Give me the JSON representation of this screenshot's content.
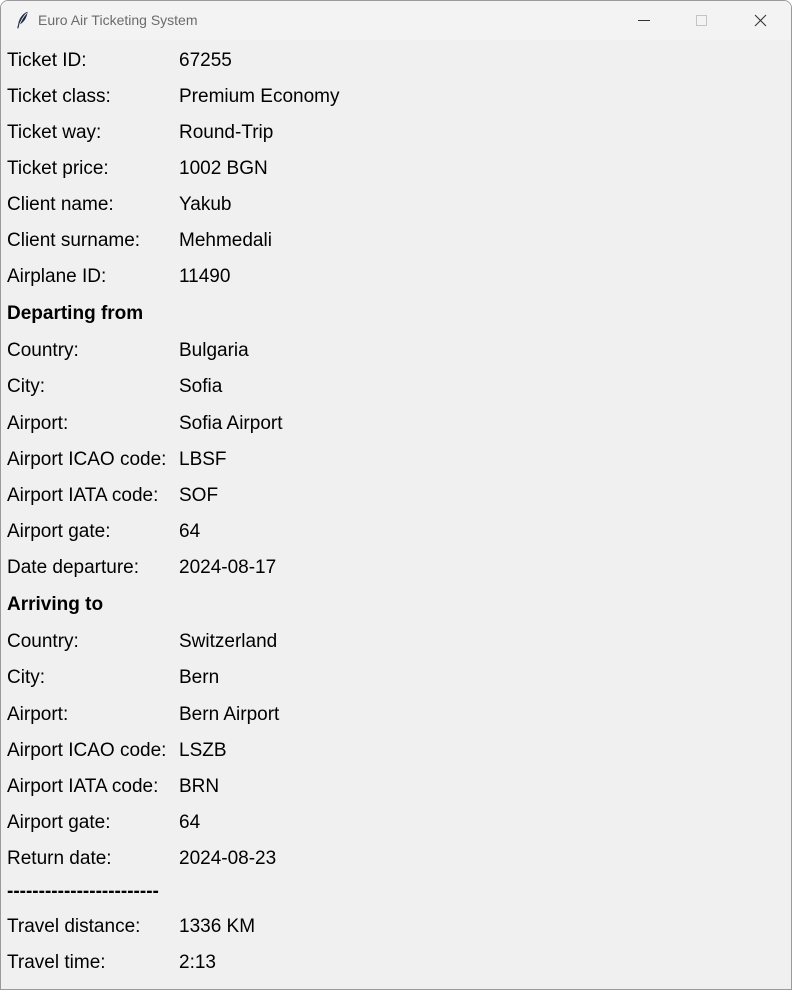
{
  "window": {
    "title": "Euro Air Ticketing System",
    "icon": "feather-icon"
  },
  "ticket": {
    "id_label": "Ticket ID:",
    "id_value": "67255",
    "class_label": "Ticket class:",
    "class_value": "Premium Economy",
    "way_label": "Ticket way:",
    "way_value": "Round-Trip",
    "price_label": "Ticket price:",
    "price_value": "1002 BGN",
    "client_name_label": "Client name:",
    "client_name_value": "Yakub",
    "client_surname_label": "Client surname:",
    "client_surname_value": "Mehmedali",
    "airplane_id_label": "Airplane ID:",
    "airplane_id_value": "11490"
  },
  "departure": {
    "heading": "Departing from",
    "country_label": "Country:",
    "country_value": "Bulgaria",
    "city_label": "City:",
    "city_value": "Sofia",
    "airport_label": "Airport:",
    "airport_value": "Sofia Airport",
    "icao_label": "Airport ICAO code:",
    "icao_value": "LBSF",
    "iata_label": "Airport IATA code:",
    "iata_value": "SOF",
    "gate_label": "Airport gate:",
    "gate_value": "64",
    "date_label": "Date departure:",
    "date_value": "2024-08-17"
  },
  "arrival": {
    "heading": "Arriving to",
    "country_label": "Country:",
    "country_value": "Switzerland",
    "city_label": "City:",
    "city_value": "Bern",
    "airport_label": "Airport:",
    "airport_value": "Bern Airport",
    "icao_label": "Airport ICAO code:",
    "icao_value": "LSZB",
    "iata_label": "Airport IATA code:",
    "iata_value": "BRN",
    "gate_label": "Airport gate:",
    "gate_value": "64",
    "date_label": "Return date:",
    "date_value": "2024-08-23"
  },
  "separator": "------------------------",
  "travel": {
    "distance_label": "Travel distance:",
    "distance_value": "1336 KM",
    "time_label": "Travel time:",
    "time_value": "2:13"
  }
}
